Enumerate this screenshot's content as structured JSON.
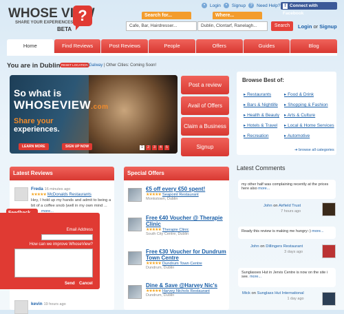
{
  "header": {
    "logo_title": "WHOSE VIEW",
    "logo_sub": "SHARE YOUR EXPERIENCES",
    "logo_beta": "BETA",
    "logo_mark": "?",
    "top_links": {
      "login": "Login",
      "signup": "Signup",
      "help": "Need Help?"
    },
    "facebook_label": "Connect with Facebook",
    "search_label": "Search for...",
    "search_placeholder": "Cafe, Bar, Hairdresser...",
    "where_label": "Where...",
    "where_placeholder": "Dublin, Clontarf, Ranelagh...",
    "search_button": "Search",
    "auth_login": "Login",
    "auth_or": "or",
    "auth_signup": "Signup"
  },
  "nav": [
    "Home",
    "Find Reviews",
    "Post Reviews",
    "People",
    "Offers",
    "Guides",
    "Blog"
  ],
  "location": {
    "label": "You are in Dublin",
    "reset": "RESET LOCATION",
    "galway": "Galway",
    "coming": "Other Cities: Coming Soon!"
  },
  "hero": {
    "line1": "So what is",
    "line2": "WHOSEVIEW",
    "line2b": ".com",
    "line3": "Share your",
    "line4": "experiences.",
    "learn": "LEARN MORE",
    "signup": "SIGN UP NOW",
    "pages": [
      "1",
      "2",
      "3",
      "4",
      "5"
    ]
  },
  "actions": [
    "Post a review",
    "Avail of Offers",
    "Claim a Business",
    "Signup"
  ],
  "browse": {
    "title": "Browse Best of:",
    "left": [
      "Restaurants",
      "Bars & Nightlife",
      "Health & Beauty",
      "Hotels & Travel",
      "Recreation"
    ],
    "right": [
      "Food & Drink",
      "Shopping & Fashion",
      "Arts & Culture",
      "Local & Home Services",
      "Automotive"
    ],
    "all": "browse all categories"
  },
  "reviews": {
    "title": "Latest Reviews",
    "items": [
      {
        "name": "Freda",
        "time": "16 minutes ago",
        "place": "McDonalds Restaurants",
        "text": "Hey, I hold up my hands and admit to being a bit of a coffee snob (well in my own mind ...",
        "more": "more..."
      },
      {
        "name": "kevin",
        "time": "19 hours ago"
      }
    ]
  },
  "offers": {
    "title": "Special Offers",
    "items": [
      {
        "title": "€5 off every €50 spent!",
        "place": "Seapoint Restaurant",
        "area": "Monkstown, Dublin"
      },
      {
        "title": "Free €40 Voucher @ Therapie Clinic",
        "place": "Therapie Clinic",
        "area": "South City Centre, Dublin"
      },
      {
        "title": "Free €30 Voucher for Dundrum Town Centre",
        "place": "Dundrum Town Centre",
        "area": "Dundrum, Dublin"
      },
      {
        "title": "Dine & Save @Harvey Nic's",
        "place": "Harvey Nichols Restaurant",
        "area": "Dundrum, Dublin"
      }
    ]
  },
  "comments": {
    "title": "Latest Comments",
    "items": [
      {
        "text": "my other half was complaining recently at the prices here also",
        "more": "more...",
        "user": "John",
        "on": "on",
        "place": "Airfield Trust",
        "time": "7 hours ago"
      },
      {
        "text": "Ready this review is making me hungry:-)",
        "more": "more...",
        "user": "John",
        "on": "on",
        "place": "Dillingers Restaurant",
        "time": "3 days ago"
      },
      {
        "text": "Sunglasses Hut in Jervis Centre is now on the site i see.",
        "more": "more...",
        "user": "Mick",
        "on": "on",
        "place": "Sunglass Hut International",
        "time": "1 day ago"
      }
    ]
  },
  "feedback": {
    "tab": "Feedback",
    "email": "Email Address",
    "question": "How can we improve WhoseView?",
    "send": "Send",
    "cancel": "Cancel"
  }
}
